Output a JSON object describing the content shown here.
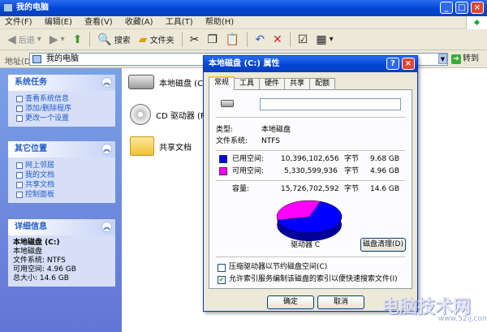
{
  "window": {
    "title": "我的电脑",
    "min": "_",
    "max": "□",
    "close": "×"
  },
  "menu": [
    "文件(F)",
    "编辑(E)",
    "查看(V)",
    "收藏(A)",
    "工具(T)",
    "帮助(H)"
  ],
  "toolbar": {
    "back": "后退",
    "forward": "",
    "search": "搜索",
    "folders": "文件夹"
  },
  "address": {
    "label": "地址(D)",
    "value": "我的电脑",
    "go": "转到"
  },
  "sidebar": {
    "tasks": {
      "title": "系统任务",
      "items": [
        "查看系统信息",
        "添加/删除程序",
        "更改一个设置"
      ]
    },
    "places": {
      "title": "其它位置",
      "items": [
        "网上邻居",
        "我的文档",
        "共享文档",
        "控制面板"
      ]
    },
    "details": {
      "title": "详细信息",
      "name": "本地磁盘 (C:)",
      "type": "本地磁盘",
      "fs": "文件系统: NTFS",
      "free": "可用空间: 4.96 GB",
      "total": "总大小: 14.6 GB"
    }
  },
  "files": [
    {
      "label": "本地磁盘 (C:)"
    },
    {
      "label": "CD 驱动器 (F:)"
    },
    {
      "label": "共享文档"
    }
  ],
  "dialog": {
    "title": "本地磁盘 (C:) 属性",
    "help": "?",
    "close": "×",
    "tabs": [
      "常规",
      "工具",
      "硬件",
      "共享",
      "配额"
    ],
    "type_label": "类型:",
    "type_value": "本地磁盘",
    "fs_label": "文件系统:",
    "fs_value": "NTFS",
    "used_label": "已用空间:",
    "used_bytes": "10,396,102,656",
    "used_unit": "字节",
    "used_gb": "9.68 GB",
    "free_label": "可用空间:",
    "free_bytes": "5,330,599,936",
    "free_unit": "字节",
    "free_gb": "4.96 GB",
    "cap_label": "容量:",
    "cap_bytes": "15,726,702,592",
    "cap_unit": "字节",
    "cap_gb": "14.6 GB",
    "drive_label": "驱动器 C",
    "cleanup": "磁盘清理(D)",
    "compress": "压缩驱动器以节约磁盘空间(C)",
    "index": "允许索引服务编制该磁盘的索引以便快速搜索文件(I)",
    "ok": "确定",
    "cancel": "取消"
  },
  "colors": {
    "used": "#0000ff",
    "free": "#ff00ff"
  },
  "chart_data": {
    "type": "pie",
    "categories": [
      "已用空间",
      "可用空间"
    ],
    "values": [
      9.68,
      4.96
    ]
  },
  "watermark": {
    "main": "电脑技术网",
    "sub": "www.52ij.com"
  }
}
